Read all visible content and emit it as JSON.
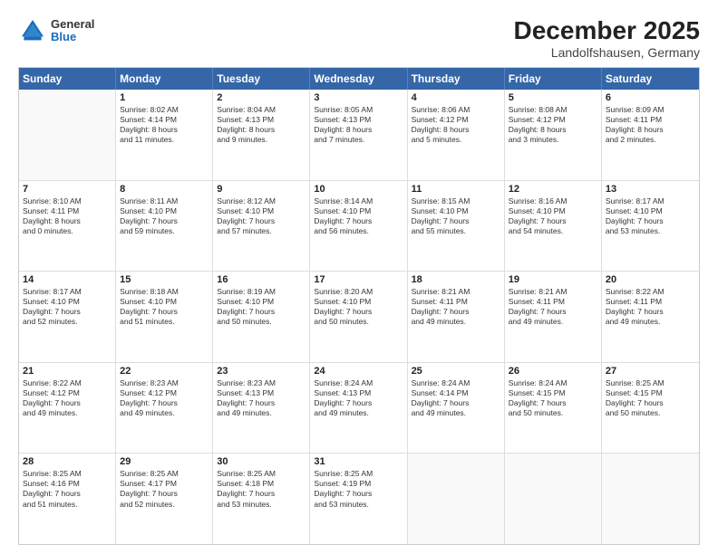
{
  "header": {
    "logo": {
      "general": "General",
      "blue": "Blue"
    },
    "title": "December 2025",
    "location": "Landolfshausen, Germany"
  },
  "weekdays": [
    "Sunday",
    "Monday",
    "Tuesday",
    "Wednesday",
    "Thursday",
    "Friday",
    "Saturday"
  ],
  "weeks": [
    [
      {
        "day": "",
        "sunrise": "",
        "sunset": "",
        "daylight": ""
      },
      {
        "day": "1",
        "sunrise": "Sunrise: 8:02 AM",
        "sunset": "Sunset: 4:14 PM",
        "daylight": "Daylight: 8 hours and 11 minutes."
      },
      {
        "day": "2",
        "sunrise": "Sunrise: 8:04 AM",
        "sunset": "Sunset: 4:13 PM",
        "daylight": "Daylight: 8 hours and 9 minutes."
      },
      {
        "day": "3",
        "sunrise": "Sunrise: 8:05 AM",
        "sunset": "Sunset: 4:13 PM",
        "daylight": "Daylight: 8 hours and 7 minutes."
      },
      {
        "day": "4",
        "sunrise": "Sunrise: 8:06 AM",
        "sunset": "Sunset: 4:12 PM",
        "daylight": "Daylight: 8 hours and 5 minutes."
      },
      {
        "day": "5",
        "sunrise": "Sunrise: 8:08 AM",
        "sunset": "Sunset: 4:12 PM",
        "daylight": "Daylight: 8 hours and 3 minutes."
      },
      {
        "day": "6",
        "sunrise": "Sunrise: 8:09 AM",
        "sunset": "Sunset: 4:11 PM",
        "daylight": "Daylight: 8 hours and 2 minutes."
      }
    ],
    [
      {
        "day": "7",
        "sunrise": "Sunrise: 8:10 AM",
        "sunset": "Sunset: 4:11 PM",
        "daylight": "Daylight: 8 hours and 0 minutes."
      },
      {
        "day": "8",
        "sunrise": "Sunrise: 8:11 AM",
        "sunset": "Sunset: 4:10 PM",
        "daylight": "Daylight: 7 hours and 59 minutes."
      },
      {
        "day": "9",
        "sunrise": "Sunrise: 8:12 AM",
        "sunset": "Sunset: 4:10 PM",
        "daylight": "Daylight: 7 hours and 57 minutes."
      },
      {
        "day": "10",
        "sunrise": "Sunrise: 8:14 AM",
        "sunset": "Sunset: 4:10 PM",
        "daylight": "Daylight: 7 hours and 56 minutes."
      },
      {
        "day": "11",
        "sunrise": "Sunrise: 8:15 AM",
        "sunset": "Sunset: 4:10 PM",
        "daylight": "Daylight: 7 hours and 55 minutes."
      },
      {
        "day": "12",
        "sunrise": "Sunrise: 8:16 AM",
        "sunset": "Sunset: 4:10 PM",
        "daylight": "Daylight: 7 hours and 54 minutes."
      },
      {
        "day": "13",
        "sunrise": "Sunrise: 8:17 AM",
        "sunset": "Sunset: 4:10 PM",
        "daylight": "Daylight: 7 hours and 53 minutes."
      }
    ],
    [
      {
        "day": "14",
        "sunrise": "Sunrise: 8:17 AM",
        "sunset": "Sunset: 4:10 PM",
        "daylight": "Daylight: 7 hours and 52 minutes."
      },
      {
        "day": "15",
        "sunrise": "Sunrise: 8:18 AM",
        "sunset": "Sunset: 4:10 PM",
        "daylight": "Daylight: 7 hours and 51 minutes."
      },
      {
        "day": "16",
        "sunrise": "Sunrise: 8:19 AM",
        "sunset": "Sunset: 4:10 PM",
        "daylight": "Daylight: 7 hours and 50 minutes."
      },
      {
        "day": "17",
        "sunrise": "Sunrise: 8:20 AM",
        "sunset": "Sunset: 4:10 PM",
        "daylight": "Daylight: 7 hours and 50 minutes."
      },
      {
        "day": "18",
        "sunrise": "Sunrise: 8:21 AM",
        "sunset": "Sunset: 4:11 PM",
        "daylight": "Daylight: 7 hours and 49 minutes."
      },
      {
        "day": "19",
        "sunrise": "Sunrise: 8:21 AM",
        "sunset": "Sunset: 4:11 PM",
        "daylight": "Daylight: 7 hours and 49 minutes."
      },
      {
        "day": "20",
        "sunrise": "Sunrise: 8:22 AM",
        "sunset": "Sunset: 4:11 PM",
        "daylight": "Daylight: 7 hours and 49 minutes."
      }
    ],
    [
      {
        "day": "21",
        "sunrise": "Sunrise: 8:22 AM",
        "sunset": "Sunset: 4:12 PM",
        "daylight": "Daylight: 7 hours and 49 minutes."
      },
      {
        "day": "22",
        "sunrise": "Sunrise: 8:23 AM",
        "sunset": "Sunset: 4:12 PM",
        "daylight": "Daylight: 7 hours and 49 minutes."
      },
      {
        "day": "23",
        "sunrise": "Sunrise: 8:23 AM",
        "sunset": "Sunset: 4:13 PM",
        "daylight": "Daylight: 7 hours and 49 minutes."
      },
      {
        "day": "24",
        "sunrise": "Sunrise: 8:24 AM",
        "sunset": "Sunset: 4:13 PM",
        "daylight": "Daylight: 7 hours and 49 minutes."
      },
      {
        "day": "25",
        "sunrise": "Sunrise: 8:24 AM",
        "sunset": "Sunset: 4:14 PM",
        "daylight": "Daylight: 7 hours and 49 minutes."
      },
      {
        "day": "26",
        "sunrise": "Sunrise: 8:24 AM",
        "sunset": "Sunset: 4:15 PM",
        "daylight": "Daylight: 7 hours and 50 minutes."
      },
      {
        "day": "27",
        "sunrise": "Sunrise: 8:25 AM",
        "sunset": "Sunset: 4:15 PM",
        "daylight": "Daylight: 7 hours and 50 minutes."
      }
    ],
    [
      {
        "day": "28",
        "sunrise": "Sunrise: 8:25 AM",
        "sunset": "Sunset: 4:16 PM",
        "daylight": "Daylight: 7 hours and 51 minutes."
      },
      {
        "day": "29",
        "sunrise": "Sunrise: 8:25 AM",
        "sunset": "Sunset: 4:17 PM",
        "daylight": "Daylight: 7 hours and 52 minutes."
      },
      {
        "day": "30",
        "sunrise": "Sunrise: 8:25 AM",
        "sunset": "Sunset: 4:18 PM",
        "daylight": "Daylight: 7 hours and 53 minutes."
      },
      {
        "day": "31",
        "sunrise": "Sunrise: 8:25 AM",
        "sunset": "Sunset: 4:19 PM",
        "daylight": "Daylight: 7 hours and 53 minutes."
      },
      {
        "day": "",
        "sunrise": "",
        "sunset": "",
        "daylight": ""
      },
      {
        "day": "",
        "sunrise": "",
        "sunset": "",
        "daylight": ""
      },
      {
        "day": "",
        "sunrise": "",
        "sunset": "",
        "daylight": ""
      }
    ]
  ]
}
